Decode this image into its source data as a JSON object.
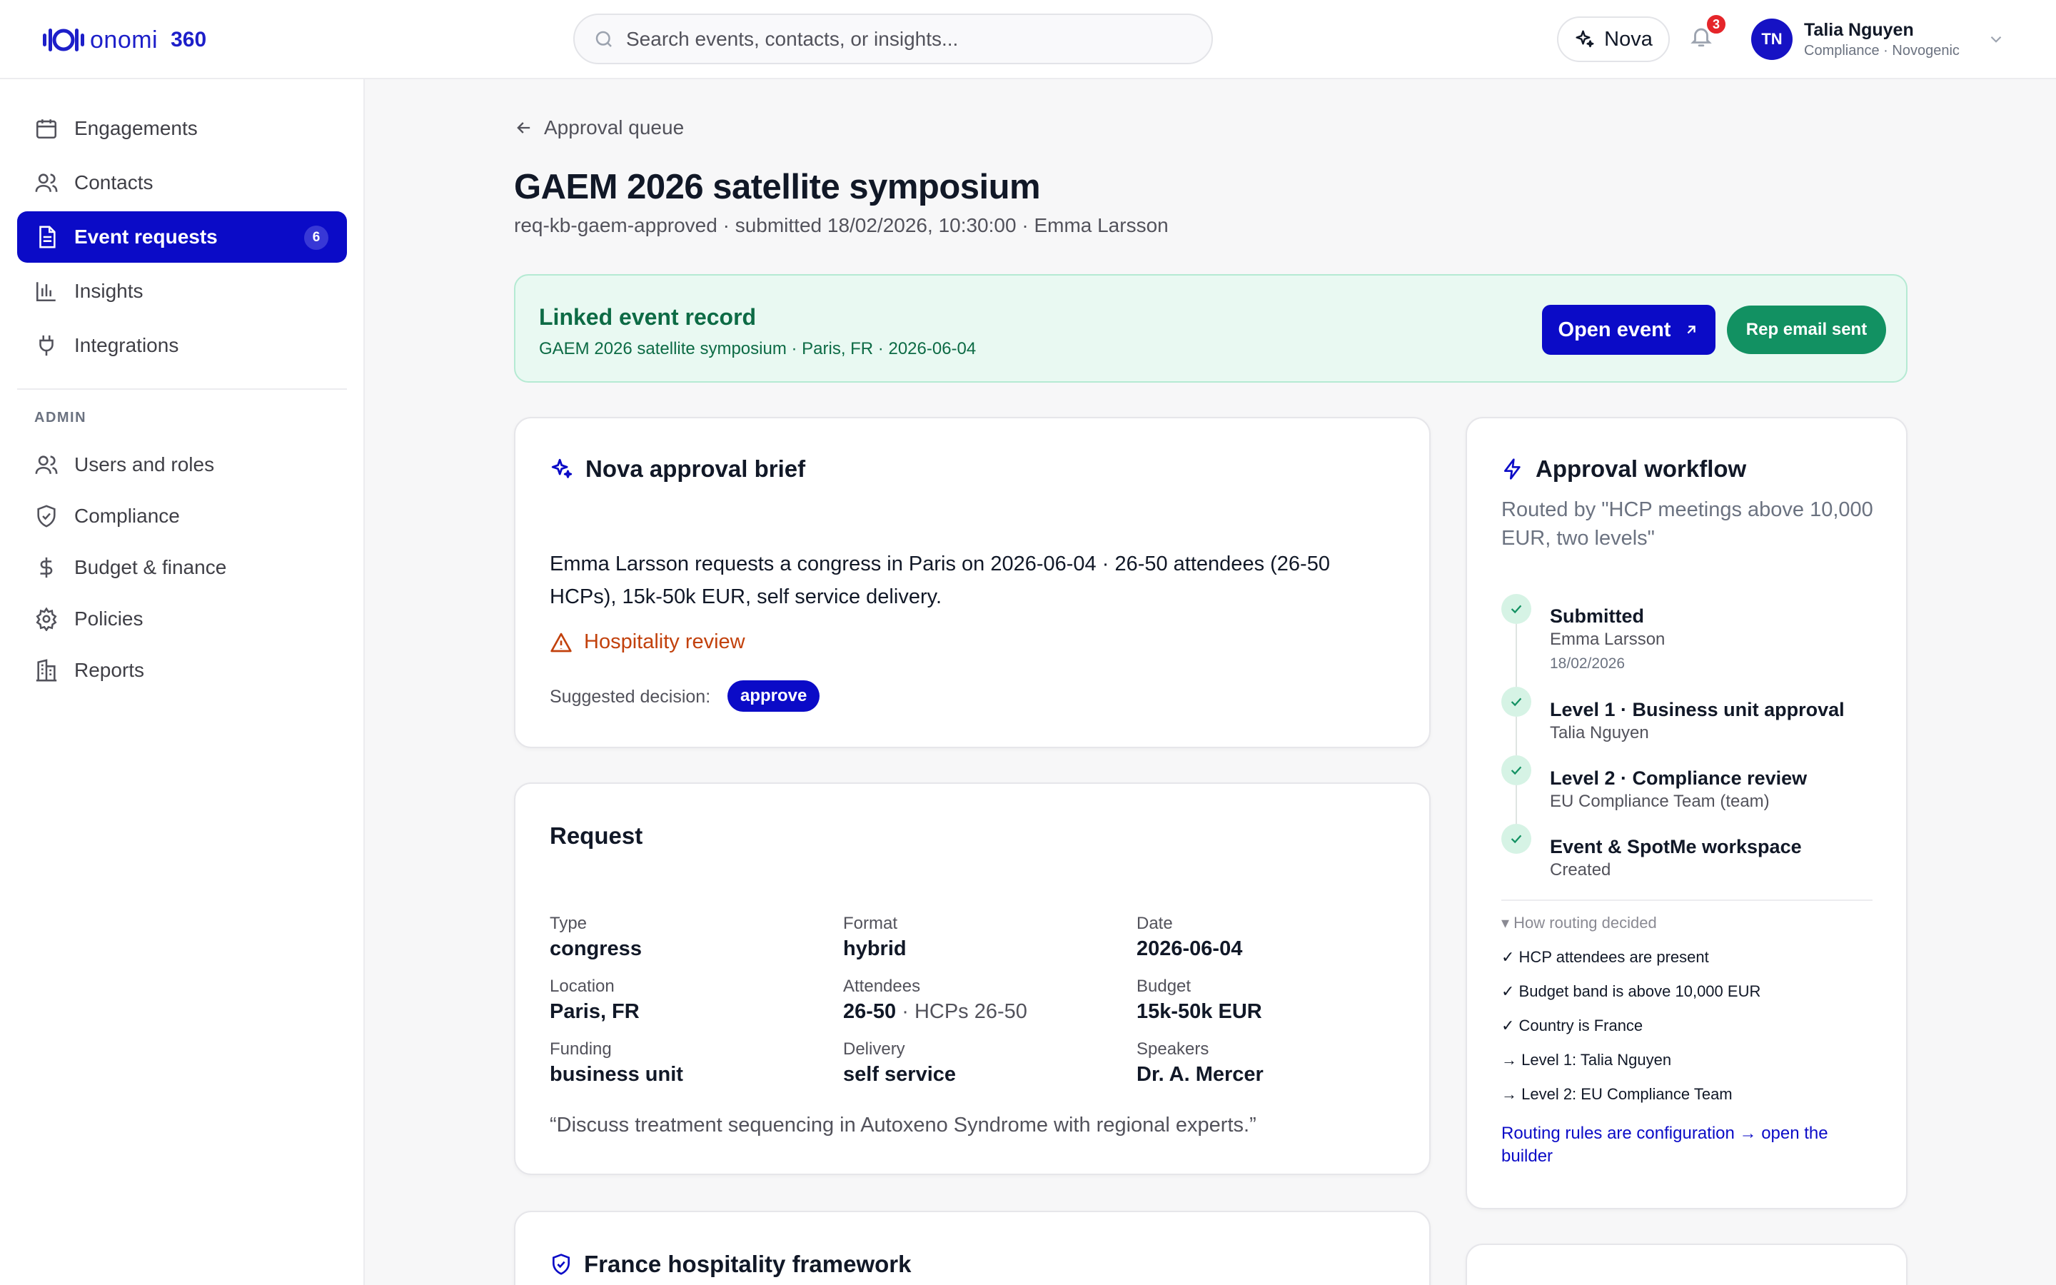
{
  "header": {
    "logo_word": "onomi",
    "logo_num": "360",
    "search_placeholder": "Search events, contacts, or insights...",
    "nova_label": "Nova",
    "notifications_count": "3",
    "user_initials": "TN",
    "user_name": "Talia Nguyen",
    "user_role": "Compliance · Novogenic"
  },
  "sidebar": {
    "items": [
      {
        "label": "Engagements",
        "icon": "calendar-icon"
      },
      {
        "label": "Contacts",
        "icon": "users-icon"
      },
      {
        "label": "Event requests",
        "icon": "document-icon",
        "badge": "6",
        "active": true
      },
      {
        "label": "Insights",
        "icon": "bar-chart-icon"
      },
      {
        "label": "Integrations",
        "icon": "plug-icon"
      }
    ],
    "admin_label": "ADMIN",
    "admin_items": [
      {
        "label": "Users and roles",
        "icon": "users-icon"
      },
      {
        "label": "Compliance",
        "icon": "shield-icon"
      },
      {
        "label": "Budget & finance",
        "icon": "dollar-icon"
      },
      {
        "label": "Policies",
        "icon": "gear-icon"
      },
      {
        "label": "Reports",
        "icon": "building-icon"
      }
    ]
  },
  "page": {
    "back_label": "Approval queue",
    "title": "GAEM 2026 satellite symposium",
    "subtitle": "req-kb-gaem-approved · submitted 18/02/2026, 10:30:00 · Emma Larsson"
  },
  "linked": {
    "title": "Linked event record",
    "meta": "GAEM 2026 satellite symposium · Paris, FR · 2026-06-04",
    "open_label": "Open event",
    "rep_email_label": "Rep email sent"
  },
  "brief": {
    "title": "Nova approval brief",
    "text": "Emma Larsson requests a congress in Paris on 2026-06-04 · 26-50 attendees (26-50 HCPs), 15k-50k EUR, self service delivery.",
    "flag": "Hospitality review",
    "suggested_label": "Suggested decision:",
    "suggested_value": "approve"
  },
  "request": {
    "title": "Request",
    "fields": [
      {
        "label": "Type",
        "value": "congress"
      },
      {
        "label": "Format",
        "value": "hybrid"
      },
      {
        "label": "Date",
        "value": "2026-06-04"
      },
      {
        "label": "Location",
        "value": "Paris, FR"
      },
      {
        "label": "Attendees",
        "value": "26-50",
        "sub": " · HCPs 26-50"
      },
      {
        "label": "Budget",
        "value": "15k-50k EUR"
      },
      {
        "label": "Funding",
        "value": "business unit"
      },
      {
        "label": "Delivery",
        "value": "self service"
      },
      {
        "label": "Speakers",
        "value": "Dr. A. Mercer"
      }
    ],
    "quote": "“Discuss treatment sequencing in Autoxeno Syndrome with regional experts.”"
  },
  "framework": {
    "title": "France hospitality framework"
  },
  "workflow": {
    "title": "Approval workflow",
    "routed": "Routed by \"HCP meetings above 10,000 EUR, two levels\"",
    "steps": [
      {
        "title": "Submitted",
        "sub": "Emma Larsson",
        "date": "18/02/2026"
      },
      {
        "title": "Level 1 · Business unit approval",
        "sub": "Talia Nguyen"
      },
      {
        "title": "Level 2 · Compliance review",
        "sub": "EU Compliance Team (team)"
      },
      {
        "title": "Event & SpotMe workspace",
        "sub": "Created"
      }
    ],
    "how_label": "▾ How routing decided",
    "rules": [
      "✓ HCP attendees are present",
      "✓ Budget band is above 10,000 EUR",
      "✓ Country is France",
      "→ Level 1: Talia Nguyen",
      "→ Level 2: EU Compliance Team"
    ],
    "link": "Routing rules are configuration → open the builder"
  },
  "colors": {
    "brand": "#0b0bc7",
    "success": "#129162",
    "warning": "#c2410c",
    "danger": "#e5252a"
  }
}
